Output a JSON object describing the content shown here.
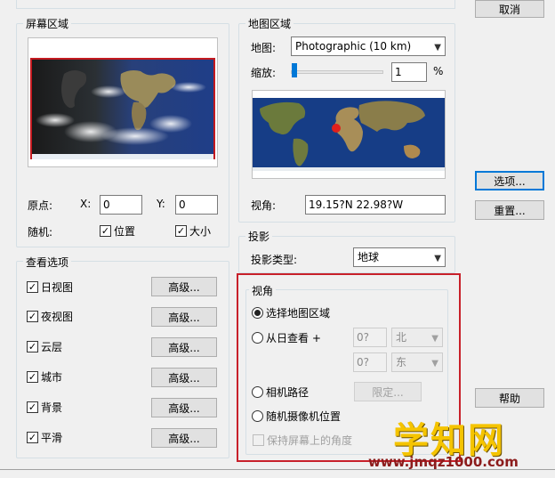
{
  "buttons": {
    "cancel": "取消",
    "options": "选项...",
    "reset": "重置...",
    "help": "帮助",
    "advanced": "高级...",
    "limit": "限定..."
  },
  "screen_area": {
    "title": "屏幕区域",
    "origin_label": "原点:",
    "x_label": "X:",
    "x_value": "0",
    "y_label": "Y:",
    "y_value": "0",
    "random_label": "随机:",
    "position_label": "位置",
    "size_label": "大小"
  },
  "map_area": {
    "title": "地图区域",
    "map_label": "地图:",
    "map_value": "Photographic (10 km)",
    "zoom_label": "缩放:",
    "zoom_value": "1",
    "zoom_unit": "%",
    "zoom_slider_fraction": 0.01,
    "view_label": "视角:",
    "view_value": "19.15?N  22.98?W"
  },
  "projection": {
    "title": "投影",
    "type_label": "投影类型:",
    "type_value": "地球"
  },
  "view_options": {
    "title": "查看选项",
    "items": [
      {
        "label": "日视图",
        "checked": true
      },
      {
        "label": "夜视图",
        "checked": true
      },
      {
        "label": "云层",
        "checked": true
      },
      {
        "label": "城市",
        "checked": true
      },
      {
        "label": "背景",
        "checked": true
      },
      {
        "label": "平滑",
        "checked": true
      }
    ]
  },
  "perspective": {
    "title": "视角",
    "select_map_area": "选择地图区域",
    "from_sun": "从日查看 +",
    "lat_value": "0?",
    "lat_dir": "北",
    "lon_value": "0?",
    "lon_dir": "东",
    "camera_path": "相机路径",
    "random_camera": "随机摄像机位置",
    "keep_screen_angle": "保持屏幕上的角度"
  },
  "watermark": {
    "brand": "学知网",
    "url": "www.jmqz1000.com"
  },
  "colors": {
    "highlight_border": "#c8202a",
    "focus_border": "#0078d7",
    "marker": "#e0201c"
  }
}
